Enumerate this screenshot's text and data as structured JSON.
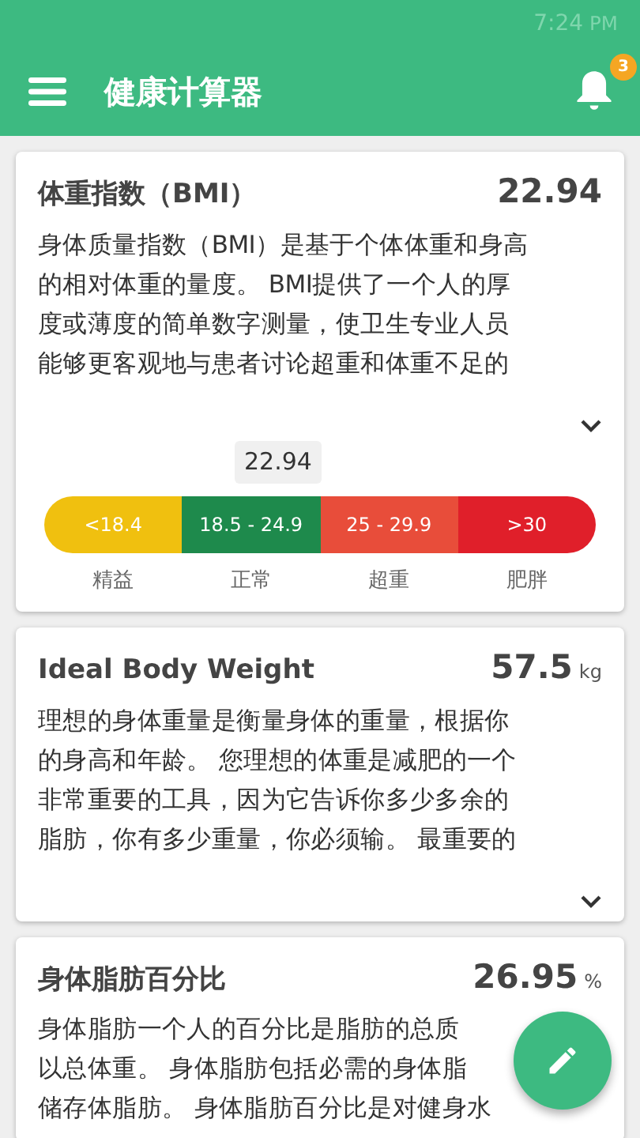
{
  "status_bar": {
    "time": "7:24",
    "period": "PM"
  },
  "app_bar": {
    "title": "健康计算器",
    "notification_count": "3"
  },
  "cards": [
    {
      "kind": "scale",
      "title": "体重指数（BMI）",
      "value": "22.94",
      "description_lines": [
        "身体质量指数（BMI）是基于个体体重和身高",
        "的相对体重的量度。 BMI提供了一个人的厚",
        "度或薄度的简单数字测量，使卫生专业人员",
        "能够更客观地与患者讨论超重和体重不足的"
      ],
      "marker": {
        "text": "22.94",
        "level": 0.424
      },
      "segments": [
        {
          "range": "<18.4",
          "label": "精益",
          "color": "#f0c00f"
        },
        {
          "range": "18.5 - 24.9",
          "label": "正常",
          "color": "#1e8a4c"
        },
        {
          "range": "25 - 29.9",
          "label": "超重",
          "color": "#e84d3a"
        },
        {
          "range": ">30",
          "label": "肥胖",
          "color": "#e01f2a"
        }
      ]
    },
    {
      "kind": "text",
      "title": "Ideal Body Weight",
      "value": "57.5",
      "unit": "kg",
      "description_lines": [
        "理想的身体重量是衡量身体的重量，根据你",
        "的身高和年龄。 您理想的体重是减肥的一个",
        "非常重要的工具，因为它告诉你多少多余的",
        "脂肪，你有多少重量，你必须输。 最重要的"
      ]
    },
    {
      "kind": "text",
      "title": "身体脂肪百分比",
      "value": "26.95",
      "unit": "%",
      "description_lines": [
        "身体脂肪一个人的百分比是脂肪的总质",
        "以总体重。 身体脂肪包括必需的身体脂",
        "储存体脂肪。 身体脂肪百分比是对健身水"
      ]
    }
  ]
}
